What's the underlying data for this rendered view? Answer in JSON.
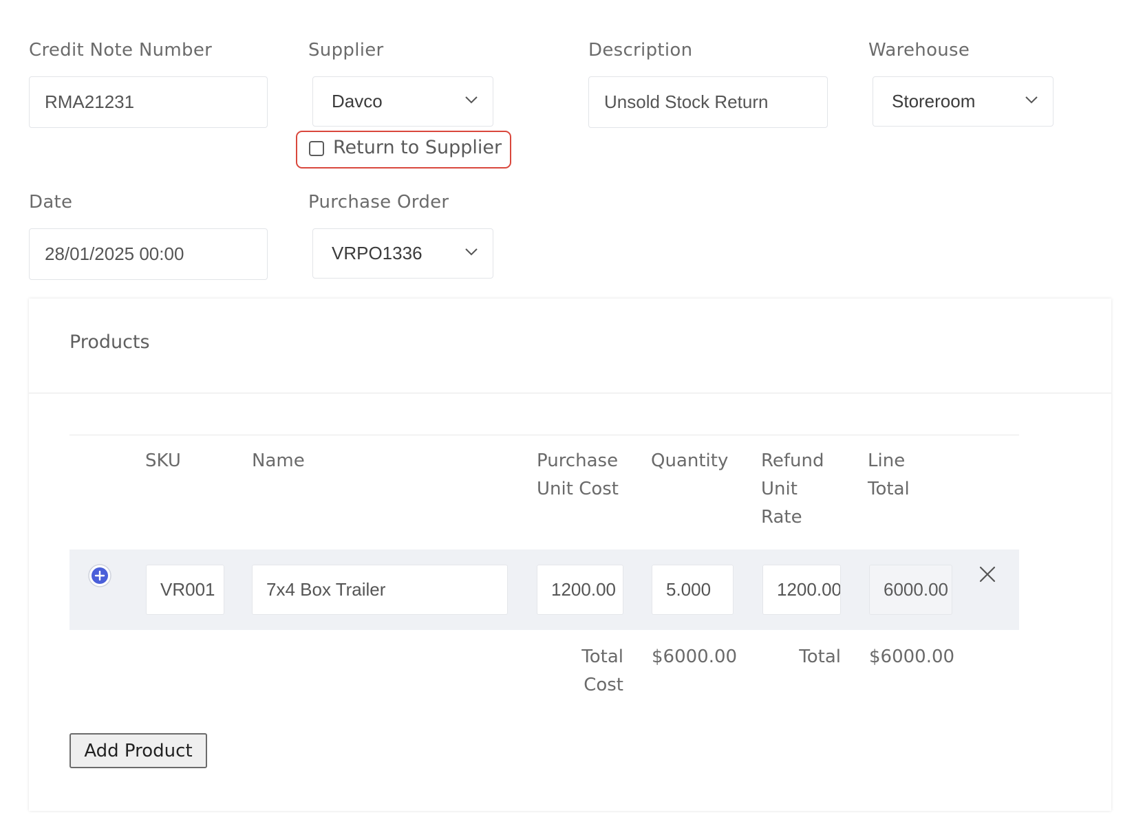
{
  "form": {
    "credit_note_number": {
      "label": "Credit Note Number",
      "value": "RMA21231"
    },
    "supplier": {
      "label": "Supplier",
      "value": "Davco"
    },
    "description": {
      "label": "Description",
      "value": "Unsold Stock Return"
    },
    "warehouse": {
      "label": "Warehouse",
      "value": "Storeroom"
    },
    "return_to_supplier": {
      "label": "Return to Supplier",
      "checked": false
    },
    "date": {
      "label": "Date",
      "value": "28/01/2025 00:00"
    },
    "purchase_order": {
      "label": "Purchase Order",
      "value": "VRPO1336"
    }
  },
  "products": {
    "title": "Products",
    "columns": {
      "sku": "SKU",
      "name": "Name",
      "purchase_unit_cost": [
        "Purchase",
        "Unit Cost"
      ],
      "quantity": "Quantity",
      "refund_unit_rate": [
        "Refund",
        "Unit",
        "Rate"
      ],
      "line_total": [
        "Line",
        "Total"
      ]
    },
    "rows": [
      {
        "sku": "VR001",
        "name": "7x4 Box Trailer",
        "purchase_unit_cost": "1200.00",
        "quantity": "5.000",
        "refund_unit_rate": "1200.00",
        "line_total": "6000.00"
      }
    ],
    "totals": {
      "total_cost_label": [
        "Total",
        "Cost"
      ],
      "total_cost_value": "$6000.00",
      "total_label": "Total",
      "total_value": "$6000.00"
    },
    "add_button": "Add Product"
  },
  "icons": {
    "chevron": "chevron-down-icon",
    "add_row": "plus-circle-icon",
    "remove_row": "close-icon"
  },
  "colors": {
    "highlight_border": "#d9473c",
    "add_row_icon": "#4a5fd9",
    "row_background": "#eff1f5"
  }
}
